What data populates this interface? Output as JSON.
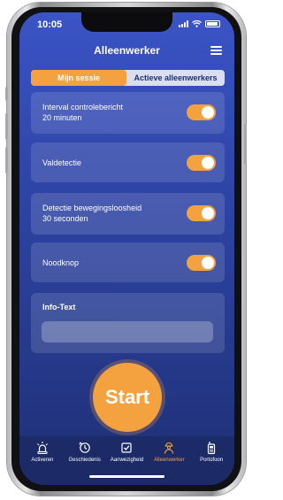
{
  "status_bar": {
    "time": "10:05"
  },
  "header": {
    "title": "Alleenwerker",
    "menu_icon": "hamburger-menu-icon"
  },
  "segmented_control": {
    "tabs": [
      {
        "label": "Mijn sessie",
        "active": true
      },
      {
        "label": "Actieve alleenwerkers",
        "active": false
      }
    ]
  },
  "settings": [
    {
      "line1": "Interval controlebericht",
      "line2": "20 minuten",
      "enabled": true
    },
    {
      "line1": "Valdetectie",
      "line2": "",
      "enabled": true
    },
    {
      "line1": "Detectie bewegingsloosheid",
      "line2": "30 seconden",
      "enabled": true
    },
    {
      "line1": "Noodknop",
      "line2": "",
      "enabled": true
    }
  ],
  "info": {
    "title": "Info-Text",
    "value": "",
    "placeholder": ""
  },
  "start_button": {
    "label": "Start"
  },
  "tab_bar": {
    "items": [
      {
        "label": "Activeren",
        "icon": "alarm-light-icon",
        "active": false
      },
      {
        "label": "Geschiedenis",
        "icon": "history-clock-icon",
        "active": false
      },
      {
        "label": "Aanwezigheid",
        "icon": "checkbox-icon",
        "active": false
      },
      {
        "label": "Alleenwerker",
        "icon": "worker-icon",
        "active": true
      },
      {
        "label": "Portofoon",
        "icon": "walkie-talkie-icon",
        "active": false
      }
    ]
  },
  "colors": {
    "accent": "#f4a140",
    "background_top": "#3b54c6",
    "background_bottom": "#1f2f76",
    "tab_bar": "#1c2a68"
  }
}
